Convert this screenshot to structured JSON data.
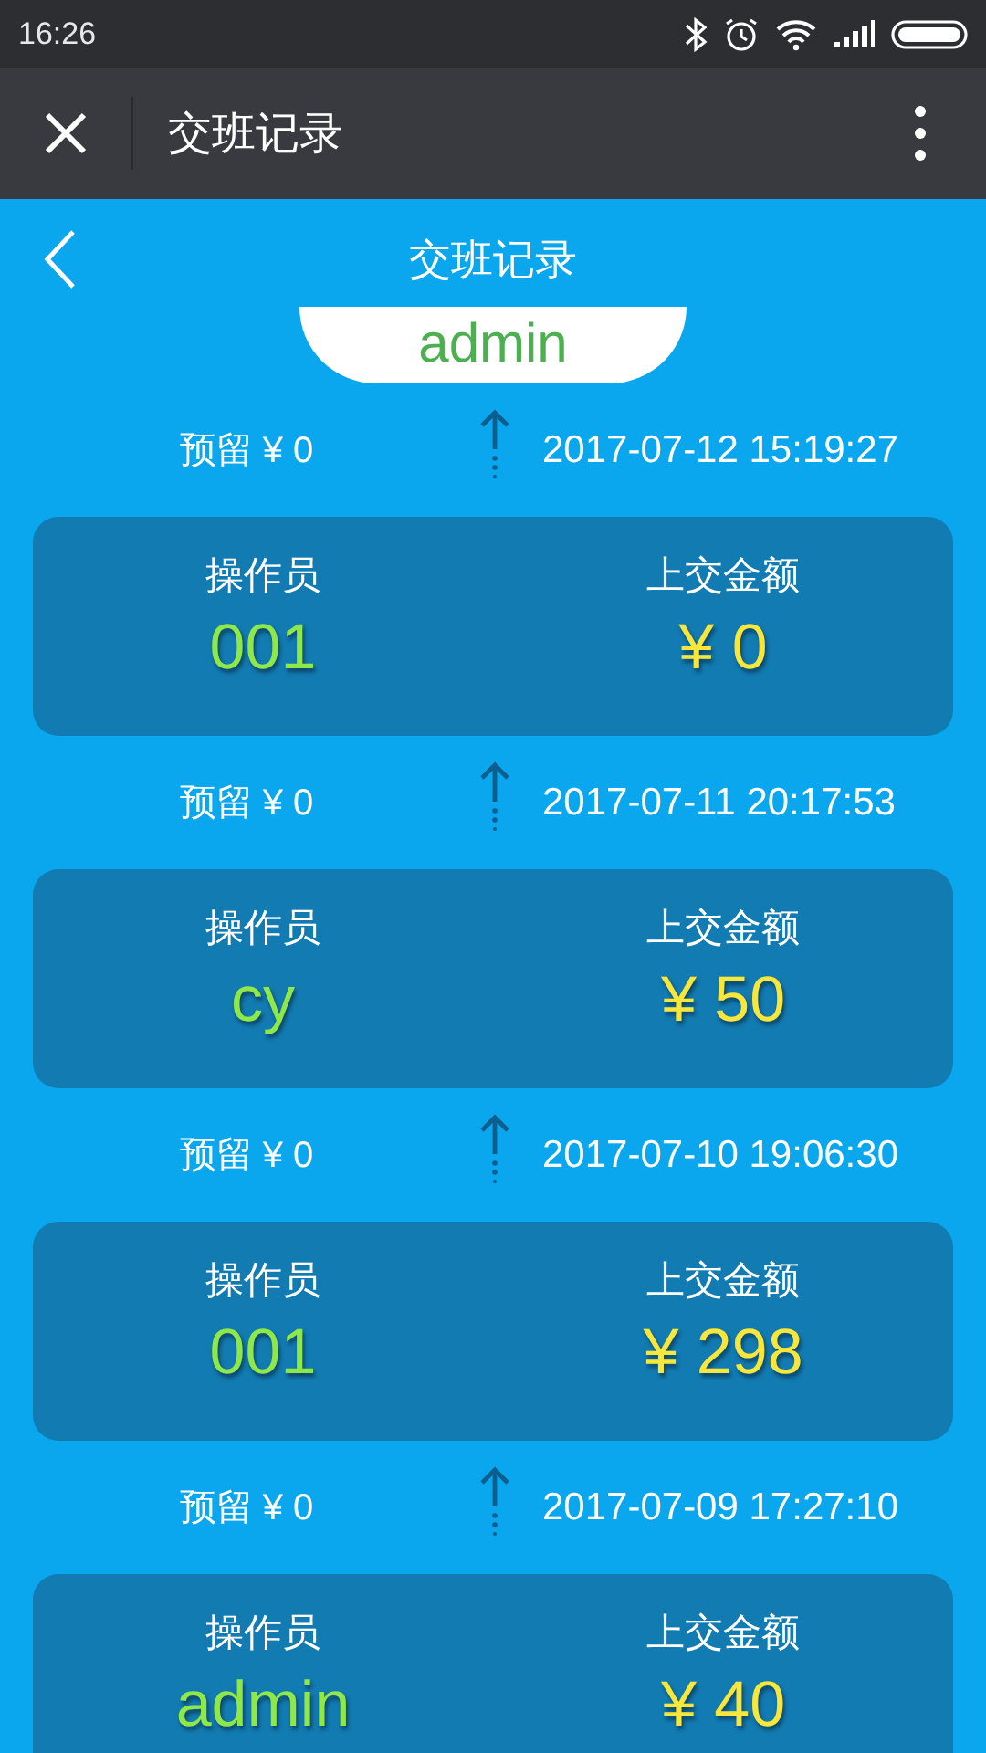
{
  "status_bar": {
    "time": "16:26"
  },
  "app_bar": {
    "title": "交班记录"
  },
  "header": {
    "title": "交班记录",
    "user": "admin"
  },
  "records": [
    {
      "reserve": "预留 ¥ 0",
      "time": "2017-07-12 15:19:27",
      "operator_label": "操作员",
      "operator": "001",
      "amount_label": "上交金额",
      "amount": "¥ 0"
    },
    {
      "reserve": "预留 ¥ 0",
      "time": "2017-07-11 20:17:53",
      "operator_label": "操作员",
      "operator": "cy",
      "amount_label": "上交金额",
      "amount": "¥ 50"
    },
    {
      "reserve": "预留 ¥ 0",
      "time": "2017-07-10 19:06:30",
      "operator_label": "操作员",
      "operator": "001",
      "amount_label": "上交金额",
      "amount": "¥ 298"
    },
    {
      "reserve": "预留 ¥ 0",
      "time": "2017-07-09 17:27:10",
      "operator_label": "操作员",
      "operator": "admin",
      "amount_label": "上交金额",
      "amount": "¥ 40"
    }
  ]
}
